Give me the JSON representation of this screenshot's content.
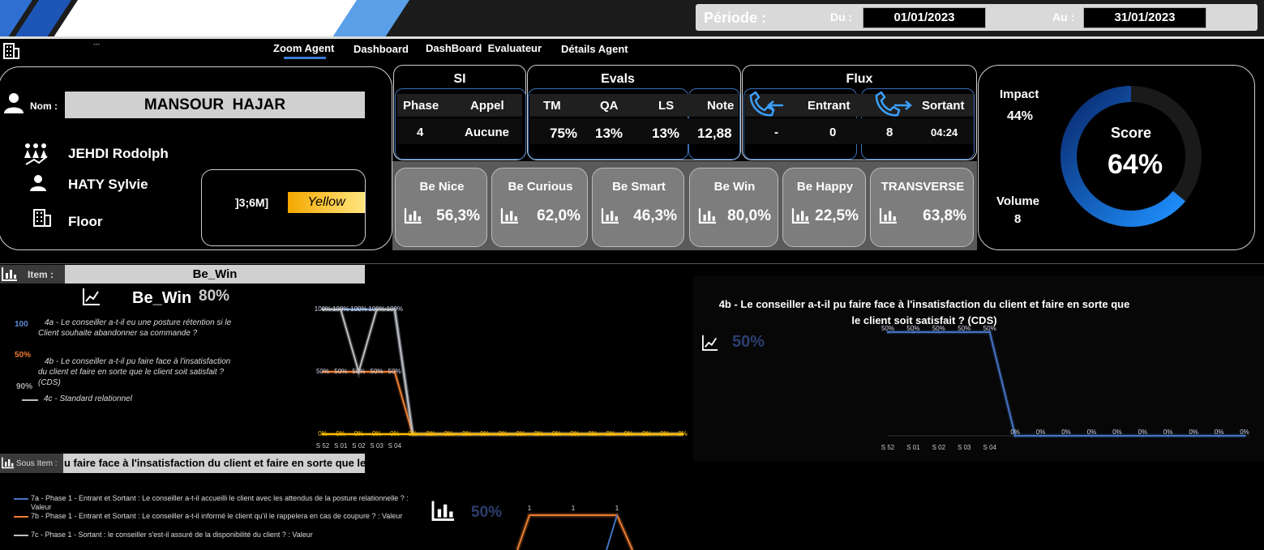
{
  "header": {
    "periode_label": "Période :",
    "du_label": "Du :",
    "du_value": "01/01/2023",
    "au_label": "Au :",
    "au_value": "31/01/2023",
    "small_mark": "---"
  },
  "nav": {
    "tabs": [
      "Zoom Agent",
      "Dashboard",
      "DashBoard  Evaluateur",
      "Détails Agent"
    ],
    "active": "Zoom Agent"
  },
  "agent": {
    "nom_label": "Nom :",
    "name": "MANSOUR  HAJAR",
    "team_leader": "JEHDI Rodolph",
    "manager": "HATY Sylvie",
    "site": "Floor",
    "seniority": "]3;6M]",
    "level": "Yellow"
  },
  "si": {
    "title": "SI",
    "phase_label": "Phase",
    "appel_label": "Appel",
    "phase_value": "4",
    "appel_value": "Aucune"
  },
  "evals": {
    "title": "Evals",
    "tm_label": "TM",
    "qa_label": "QA",
    "ls_label": "LS",
    "note_label": "Note",
    "tm_value": "75%",
    "qa_value": "13%",
    "ls_value": "13%",
    "note_value": "12,88"
  },
  "flux": {
    "title": "Flux",
    "entrant_label": "Entrant",
    "sortant_label": "Sortant",
    "entrant_a": "-",
    "entrant_b": "0",
    "sortant_a": "8",
    "sortant_b": "04:24"
  },
  "score": {
    "impact_label": "Impact",
    "impact_value": "44%",
    "volume_label": "Volume",
    "volume_value": "8",
    "score_label": "Score",
    "score_value": "64%",
    "score_fraction": 0.64
  },
  "be_cards": [
    {
      "title": "Be Nice",
      "value": "56,3%"
    },
    {
      "title": "Be Curious",
      "value": "62,0%"
    },
    {
      "title": "Be Smart",
      "value": "46,3%"
    },
    {
      "title": "Be Win",
      "value": "80,0%"
    },
    {
      "title": "Be Happy",
      "value": "22,5%"
    },
    {
      "title": "TRANSVERSE",
      "value": "63,8%"
    }
  ],
  "item": {
    "label": "Item :",
    "value": "Be_Win",
    "kpi_name": "Be_Win",
    "kpi_value": "80%",
    "legend": [
      {
        "prefix": "100",
        "text": "4a - Le conseiller a-t-il eu une posture rétention si le Client souhaite abandonner sa commande ?"
      },
      {
        "prefix": "50%",
        "text": "4b - Le conseiller a-t-il pu faire  face à l'insatisfaction du client et faire en sorte que le client soit satisfait ? (CDS)"
      },
      {
        "prefix": "90%",
        "text": "4c - Standard relationnel"
      }
    ]
  },
  "right_chart": {
    "title_line1": "4b - Le conseiller a-t-il pu faire  face à l'insatisfaction du client et faire en sorte que",
    "title_line2": "le client soit satisfait ? (CDS)",
    "kpi_value": "50%"
  },
  "sous_item": {
    "label": "Sous Item :",
    "value": "u faire  face à l'insatisfaction du client et faire en sorte que le cl",
    "kpi_value": "50%",
    "legend": [
      "7a - Phase 1 - Entrant et Sortant : Le conseiller a-t-il accueilli le client avec les attendus de la posture relationnelle ? : Valeur",
      "7b - Phase 1 - Entrant et Sortant : Le conseiller a-t-il informé le client qu'il le rappelera en cas de coupure ? : Valeur",
      "7c - Phase 1 - Sortant : le conseiller s'est-il assuré de la disponibilité du client ? : Valeur"
    ]
  },
  "chart_data": [
    {
      "type": "line",
      "x": [
        "S 52",
        "S 01",
        "S 02",
        "S 03",
        "S 04",
        "",
        "",
        "",
        "",
        "",
        "",
        "",
        "",
        "",
        "",
        "",
        "",
        "",
        "",
        "",
        ""
      ],
      "series": [
        {
          "color": "#8fa9d8",
          "values": [
            1.0,
            1.0,
            1.0,
            1.0,
            1.0,
            0,
            0,
            0,
            0,
            0,
            0,
            0,
            0,
            0,
            0,
            0,
            0,
            0,
            0,
            0,
            0
          ],
          "labels": [
            "100%",
            "100%",
            "100%",
            "100%",
            "100%"
          ]
        },
        {
          "color": "#ed7d31",
          "values": [
            0.5,
            0.5,
            0.5,
            0.5,
            0.5,
            0,
            0,
            0,
            0,
            0,
            0,
            0,
            0,
            0,
            0,
            0,
            0,
            0,
            0,
            0,
            0
          ],
          "labels": [
            "50%",
            "50%",
            "50%",
            "50%",
            "50%"
          ]
        },
        {
          "color": "#bfbfbf",
          "values": [
            1.0,
            1.0,
            0.5,
            1.0,
            1.0,
            0,
            0,
            0,
            0,
            0,
            0,
            0,
            0,
            0,
            0,
            0,
            0,
            0,
            0,
            0,
            0
          ]
        },
        {
          "color": "#ffc000",
          "values": [
            0,
            0,
            0,
            0,
            0,
            0,
            0,
            0,
            0,
            0,
            0,
            0,
            0,
            0,
            0,
            0,
            0,
            0,
            0,
            0,
            0
          ],
          "labels": [
            "0%",
            "0%",
            "0%",
            "0%",
            "0%",
            "0%",
            "0%",
            "0%",
            "0%",
            "0%",
            "0%",
            "0%",
            "0%",
            "0%",
            "0%",
            "0%",
            "0%",
            "0%",
            "0%",
            "0%",
            "0%"
          ]
        }
      ],
      "ylim": [
        0,
        1
      ]
    },
    {
      "type": "line",
      "x": [
        "S 52",
        "S 01",
        "S 02",
        "S 03",
        "S 04",
        "",
        "",
        "",
        "",
        "",
        "",
        "",
        "",
        "",
        ""
      ],
      "series": [
        {
          "color": "#4472c4",
          "values": [
            0.5,
            0.5,
            0.5,
            0.5,
            0.5,
            0,
            0,
            0,
            0,
            0,
            0,
            0,
            0,
            0,
            0
          ],
          "labels": [
            "50%",
            "50%",
            "50%",
            "50%",
            "50%",
            "0%",
            "0%",
            "0%",
            "0%",
            "0%",
            "0%",
            "0%",
            "0%",
            "0%",
            "0%"
          ]
        }
      ],
      "ylim": [
        0,
        0.5
      ]
    },
    {
      "type": "line",
      "series": [
        {
          "color": "#ed7d31",
          "values": [
            1,
            1,
            1
          ],
          "labels": [
            "1",
            "1",
            "1"
          ]
        },
        {
          "color": "#4472c4",
          "values": [
            0
          ]
        }
      ],
      "ylim": [
        0,
        1
      ]
    }
  ]
}
